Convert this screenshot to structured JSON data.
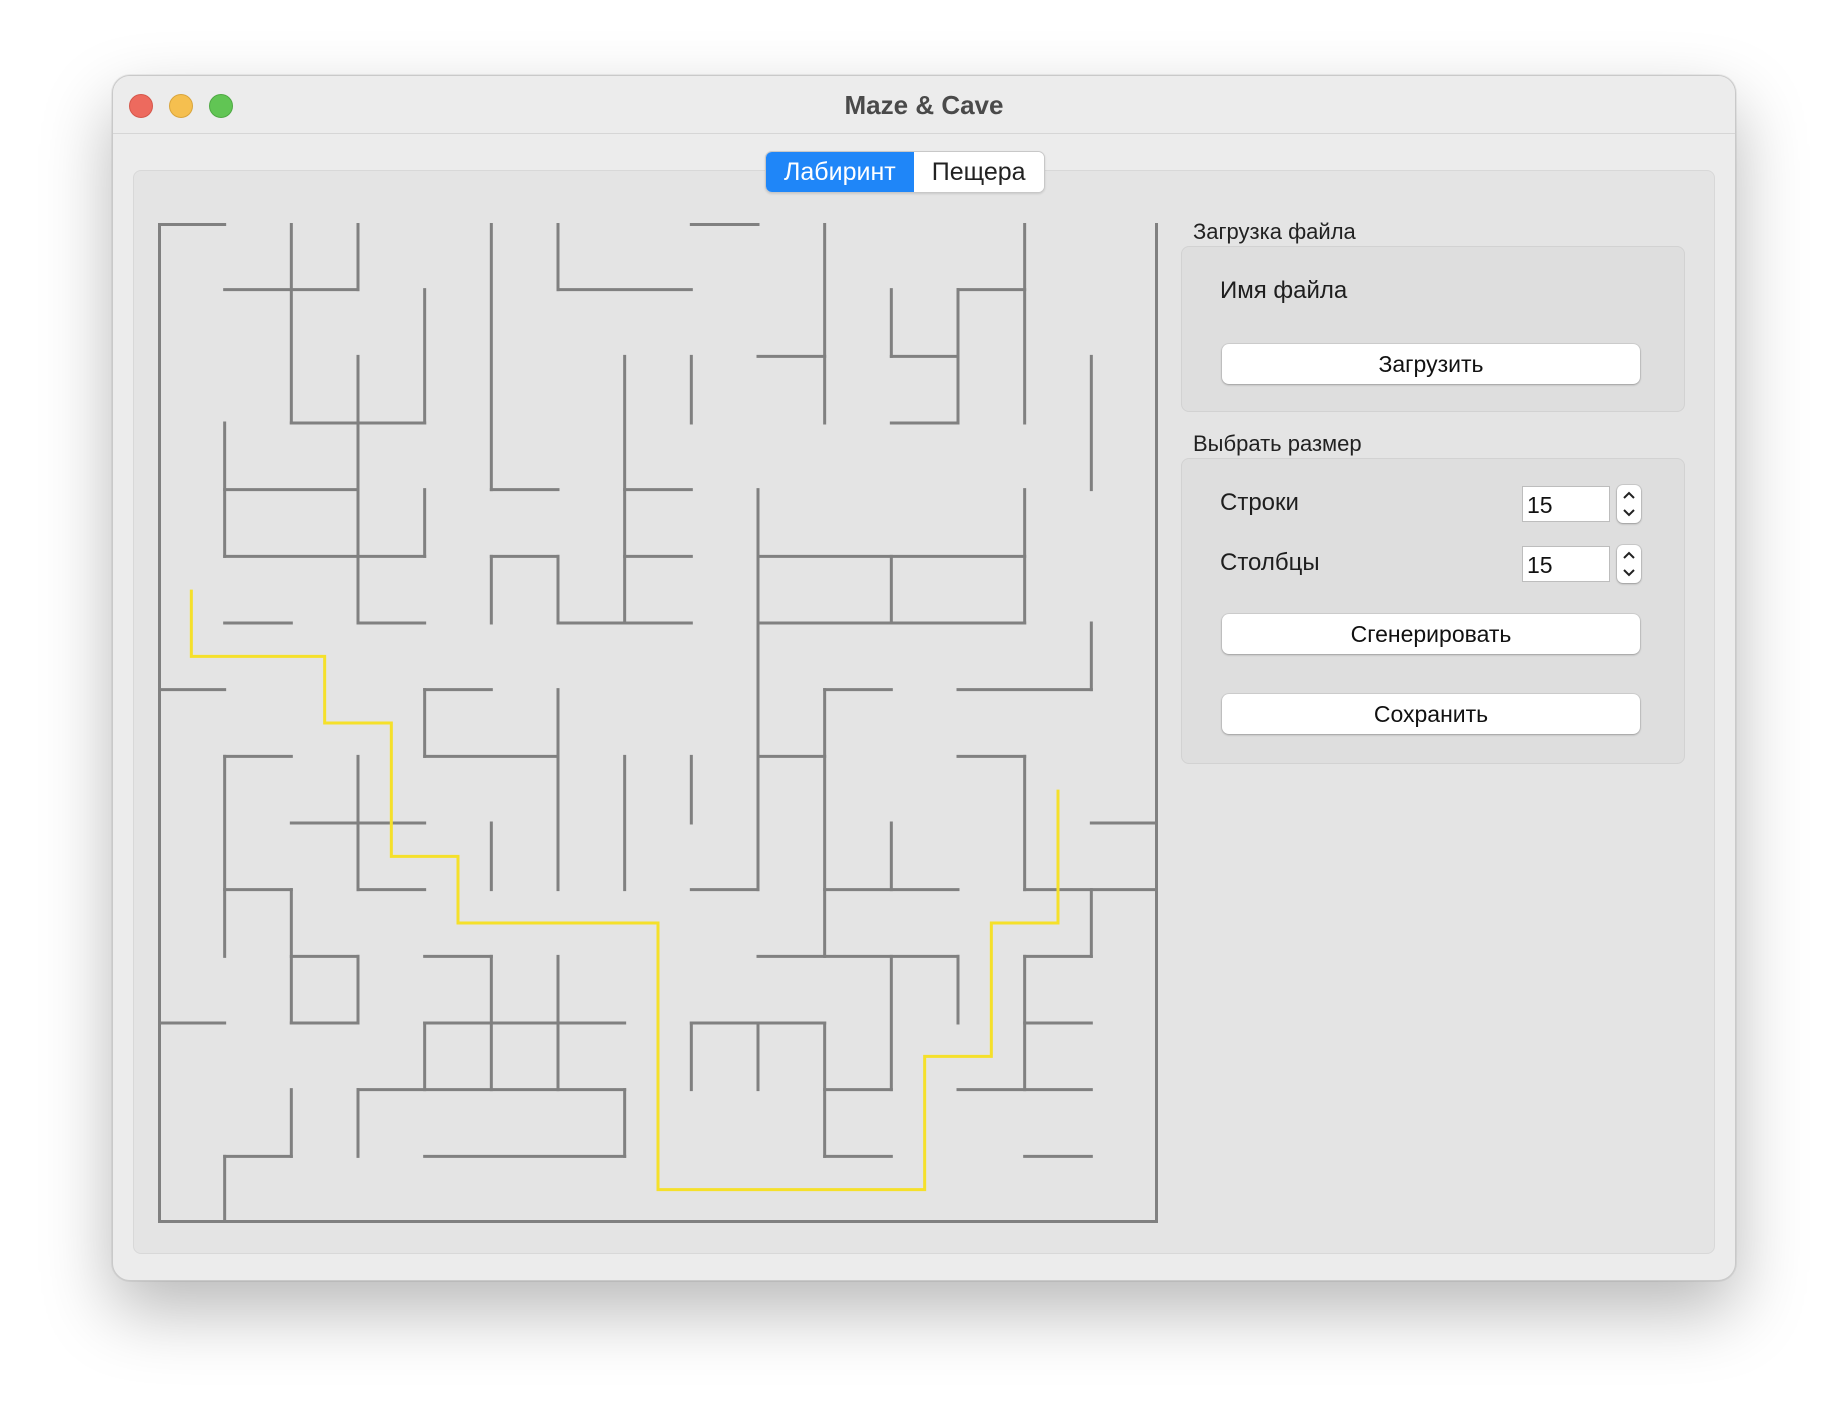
{
  "window": {
    "title": "Maze & Cave"
  },
  "tabs": [
    {
      "label": "Лабиринт",
      "selected": true
    },
    {
      "label": "Пещера",
      "selected": false
    }
  ],
  "file_section": {
    "title": "Загрузка файла",
    "filename_label": "Имя файла",
    "load_button": "Загрузить"
  },
  "size_section": {
    "title": "Выбрать размер",
    "rows_label": "Строки",
    "rows_value": "15",
    "cols_label": "Столбцы",
    "cols_value": "15",
    "generate_button": "Сгенерировать",
    "save_button": "Сохранить"
  },
  "colors": {
    "wall": "#808080",
    "path": "#f5e02a",
    "tab_active": "#1f86f8"
  },
  "maze": {
    "rows": 15,
    "cols": 15,
    "horizontal_walls": [
      [
        0,
        0,
        1
      ],
      [
        0,
        8,
        9
      ],
      [
        1,
        1,
        3
      ],
      [
        1,
        6,
        8
      ],
      [
        1,
        12,
        13
      ],
      [
        2,
        9,
        10
      ],
      [
        2,
        11,
        12
      ],
      [
        3,
        2,
        4
      ],
      [
        3,
        11,
        12
      ],
      [
        4,
        1,
        3
      ],
      [
        4,
        5,
        6
      ],
      [
        4,
        7,
        8
      ],
      [
        5,
        1,
        4
      ],
      [
        5,
        5,
        6
      ],
      [
        5,
        7,
        8
      ],
      [
        5,
        9,
        13
      ],
      [
        6,
        1,
        2
      ],
      [
        6,
        3,
        4
      ],
      [
        6,
        6,
        8
      ],
      [
        6,
        9,
        12
      ],
      [
        6,
        12,
        13
      ],
      [
        7,
        0,
        1
      ],
      [
        7,
        4,
        5
      ],
      [
        7,
        10,
        11
      ],
      [
        7,
        12,
        14
      ],
      [
        8,
        1,
        2
      ],
      [
        8,
        4,
        6
      ],
      [
        8,
        9,
        10
      ],
      [
        8,
        12,
        13
      ],
      [
        9,
        2,
        4
      ],
      [
        9,
        14,
        15
      ],
      [
        10,
        1,
        2
      ],
      [
        10,
        3,
        4
      ],
      [
        10,
        8,
        9
      ],
      [
        10,
        10,
        12
      ],
      [
        10,
        13,
        15
      ],
      [
        11,
        2,
        3
      ],
      [
        11,
        4,
        5
      ],
      [
        11,
        9,
        12
      ],
      [
        11,
        13,
        14
      ],
      [
        12,
        0,
        1
      ],
      [
        12,
        2,
        3
      ],
      [
        12,
        4,
        7
      ],
      [
        12,
        8,
        10
      ],
      [
        12,
        13,
        14
      ],
      [
        13,
        3,
        7
      ],
      [
        13,
        10,
        11
      ],
      [
        13,
        12,
        14
      ],
      [
        14,
        1,
        2
      ],
      [
        14,
        4,
        7
      ],
      [
        14,
        10,
        11
      ],
      [
        14,
        13,
        14
      ],
      [
        15,
        0,
        15
      ]
    ],
    "vertical_walls": [
      [
        0,
        0,
        15
      ],
      [
        15,
        0,
        15
      ],
      [
        1,
        3,
        5
      ],
      [
        1,
        8,
        11
      ],
      [
        1,
        14,
        15
      ],
      [
        2,
        0,
        3
      ],
      [
        2,
        10,
        12
      ],
      [
        2,
        13,
        14
      ],
      [
        3,
        0,
        1
      ],
      [
        3,
        2,
        4
      ],
      [
        3,
        4,
        6
      ],
      [
        3,
        8,
        10
      ],
      [
        3,
        11,
        12
      ],
      [
        3,
        13,
        14
      ],
      [
        4,
        1,
        3
      ],
      [
        4,
        4,
        5
      ],
      [
        4,
        7,
        8
      ],
      [
        4,
        12,
        13
      ],
      [
        5,
        0,
        4
      ],
      [
        5,
        5,
        6
      ],
      [
        5,
        9,
        10
      ],
      [
        5,
        11,
        13
      ],
      [
        6,
        0,
        1
      ],
      [
        6,
        5,
        6
      ],
      [
        6,
        7,
        10
      ],
      [
        6,
        11,
        13
      ],
      [
        7,
        2,
        6
      ],
      [
        7,
        8,
        10
      ],
      [
        7,
        13,
        14
      ],
      [
        8,
        2,
        3
      ],
      [
        8,
        8,
        9
      ],
      [
        8,
        12,
        13
      ],
      [
        9,
        4,
        10
      ],
      [
        9,
        12,
        13
      ],
      [
        10,
        0,
        3
      ],
      [
        10,
        7,
        11
      ],
      [
        10,
        12,
        14
      ],
      [
        11,
        1,
        2
      ],
      [
        11,
        5,
        6
      ],
      [
        11,
        9,
        10
      ],
      [
        11,
        11,
        13
      ],
      [
        12,
        1,
        3
      ],
      [
        12,
        11,
        12
      ],
      [
        13,
        0,
        3
      ],
      [
        13,
        4,
        6
      ],
      [
        13,
        8,
        10
      ],
      [
        13,
        11,
        13
      ],
      [
        14,
        2,
        4
      ],
      [
        14,
        6,
        7
      ],
      [
        14,
        10,
        11
      ],
      [
        15,
        0,
        15
      ]
    ],
    "solution_path": [
      [
        0.5,
        5.5
      ],
      [
        0.5,
        6.5
      ],
      [
        2.5,
        6.5
      ],
      [
        2.5,
        7.5
      ],
      [
        3.5,
        7.5
      ],
      [
        3.5,
        9.5
      ],
      [
        4.5,
        9.5
      ],
      [
        4.5,
        10.5
      ],
      [
        7.5,
        10.5
      ],
      [
        7.5,
        14.5
      ],
      [
        11.5,
        14.5
      ],
      [
        11.5,
        12.5
      ],
      [
        12.5,
        12.5
      ],
      [
        12.5,
        10.5
      ],
      [
        13.5,
        10.5
      ],
      [
        13.5,
        8.5
      ]
    ]
  }
}
